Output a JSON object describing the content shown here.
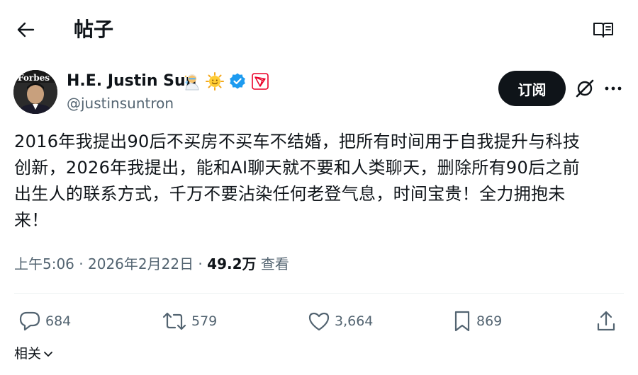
{
  "header": {
    "title": "帖子",
    "back_icon": "arrow-left-icon",
    "reader_icon": "book-open-icon"
  },
  "author": {
    "name": "H.E. Justin Sun",
    "handle": "@justinsuntron",
    "avatar_label": "Forbes",
    "badges": [
      "scientist-emoji",
      "sun-emoji",
      "verified-badge-icon",
      "tron-logo-icon"
    ]
  },
  "follow_button": {
    "label": "订阅"
  },
  "post": {
    "lines": [
      "2016年我提出90后不买房不买车不结婚，把所有时间用于自我提升与科技",
      "创新，2026年我提出，能和AI聊天就不要和人类聊天，删除所有90后之前",
      "出生人的联系方式，千万不要沾染任何老登气息，时间宝贵！全力拥抱未",
      "来！"
    ]
  },
  "meta": {
    "time": "上午5:06",
    "separator": " · ",
    "date": "2026年2月22日",
    "views_count": "49.2万",
    "views_label": "查看"
  },
  "actions": {
    "replies": "684",
    "reposts": "579",
    "likes": "3,664",
    "bookmarks": "869"
  },
  "related": {
    "label": "相关"
  },
  "colors": {
    "text": "#0f1419",
    "secondary": "#536471",
    "verified": "#1d9bf0",
    "tron": "#eb0029",
    "divider": "#eff3f4"
  }
}
